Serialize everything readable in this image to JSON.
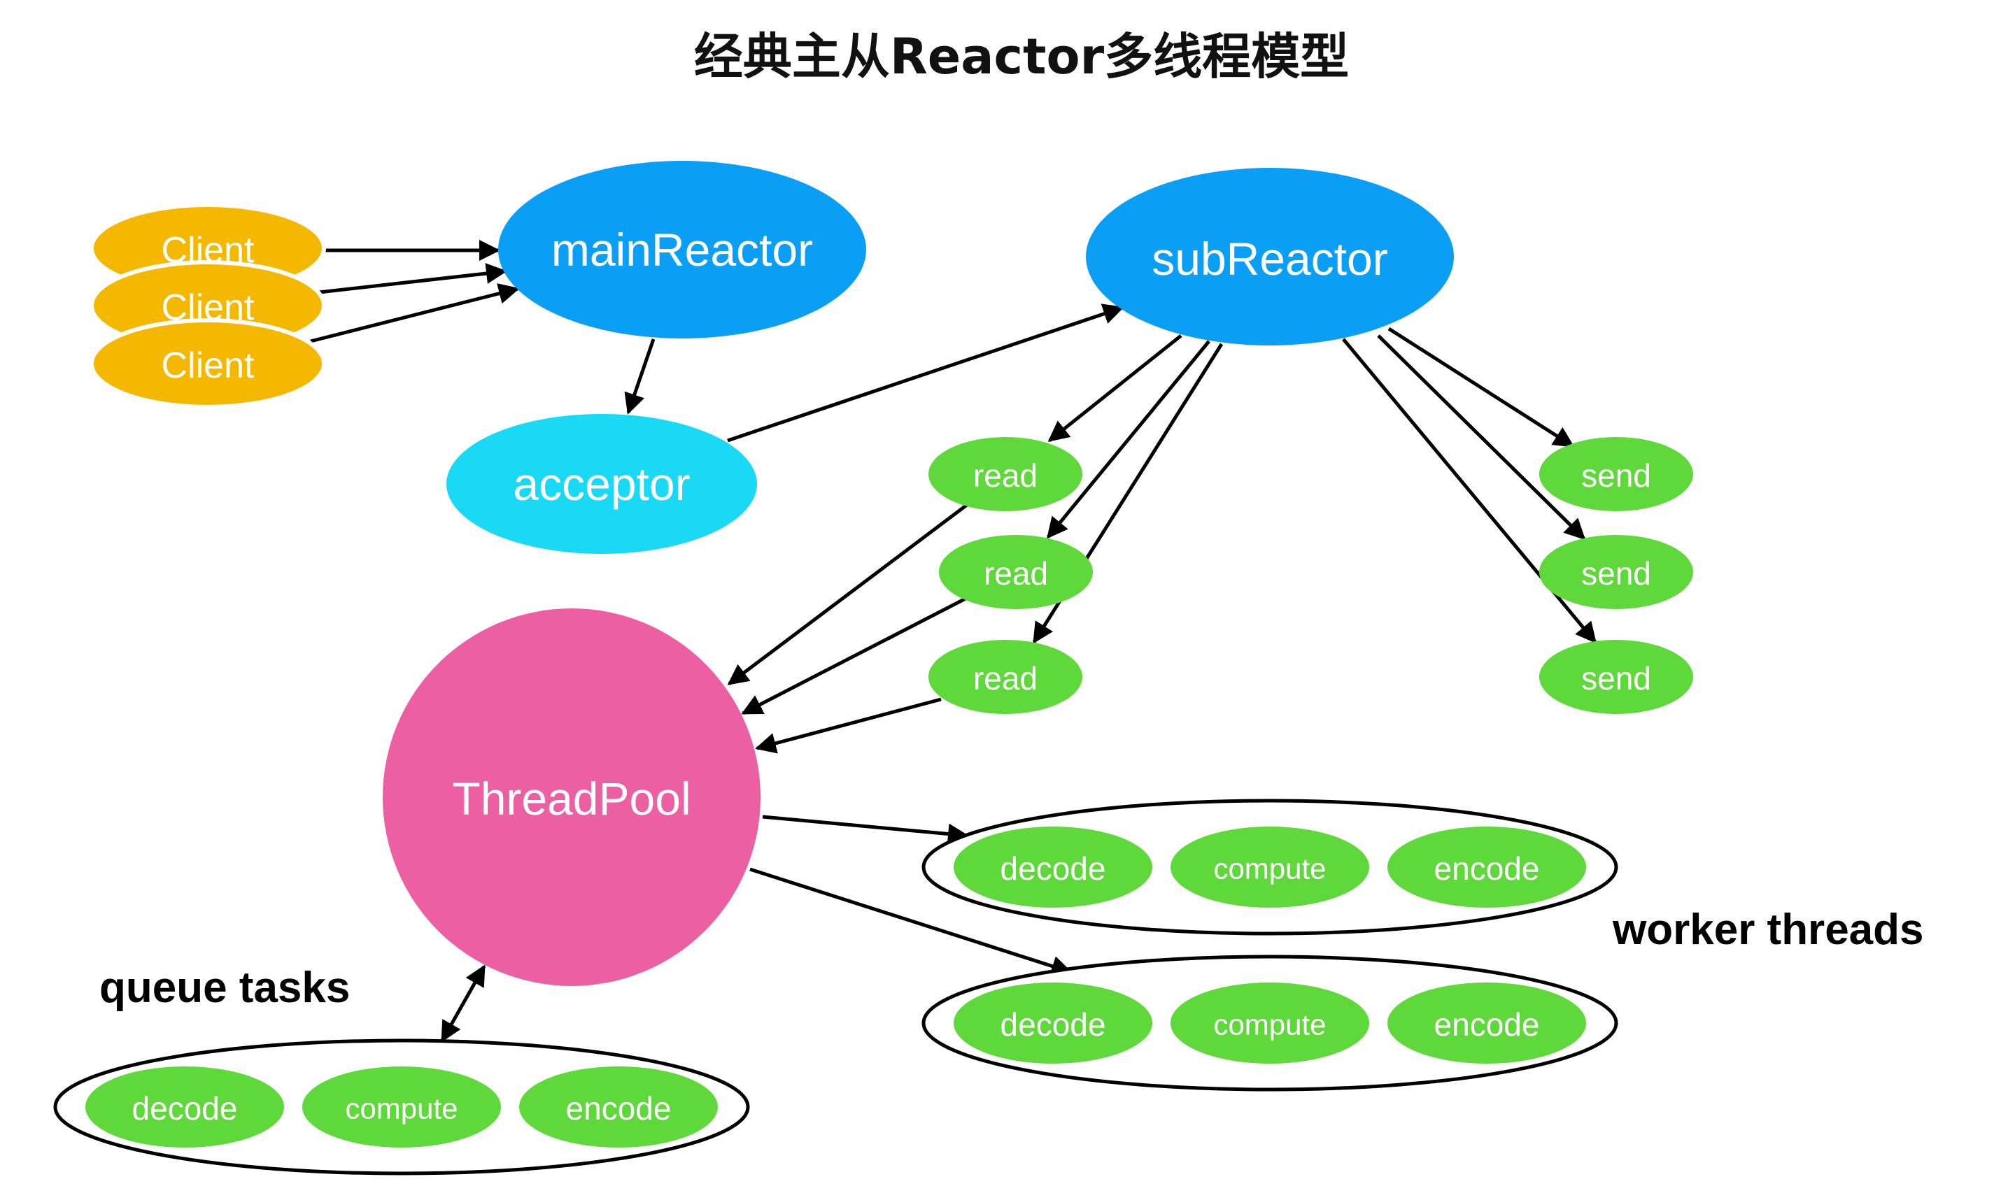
{
  "title": "经典主从Reactor多线程模型",
  "nodes": {
    "client_1": "Client",
    "client_2": "Client",
    "client_3": "Client",
    "main_reactor": "mainReactor",
    "sub_reactor": "subReactor",
    "acceptor": "acceptor",
    "thread_pool": "ThreadPool",
    "read_1": "read",
    "read_2": "read",
    "read_3": "read",
    "send_1": "send",
    "send_2": "send",
    "send_3": "send"
  },
  "worker_group_1": {
    "decode": "decode",
    "compute": "compute",
    "encode": "encode"
  },
  "worker_group_2": {
    "decode": "decode",
    "compute": "compute",
    "encode": "encode"
  },
  "queue_group": {
    "decode": "decode",
    "compute": "compute",
    "encode": "encode"
  },
  "labels": {
    "worker_threads": "worker threads",
    "queue_tasks": "queue tasks"
  },
  "colors": {
    "client": "#F5B800",
    "reactor": "#0A9EF5",
    "acceptor": "#1AD9F5",
    "thread_pool": "#EC5FA3",
    "task": "#5ED83A",
    "edge": "#000000"
  }
}
